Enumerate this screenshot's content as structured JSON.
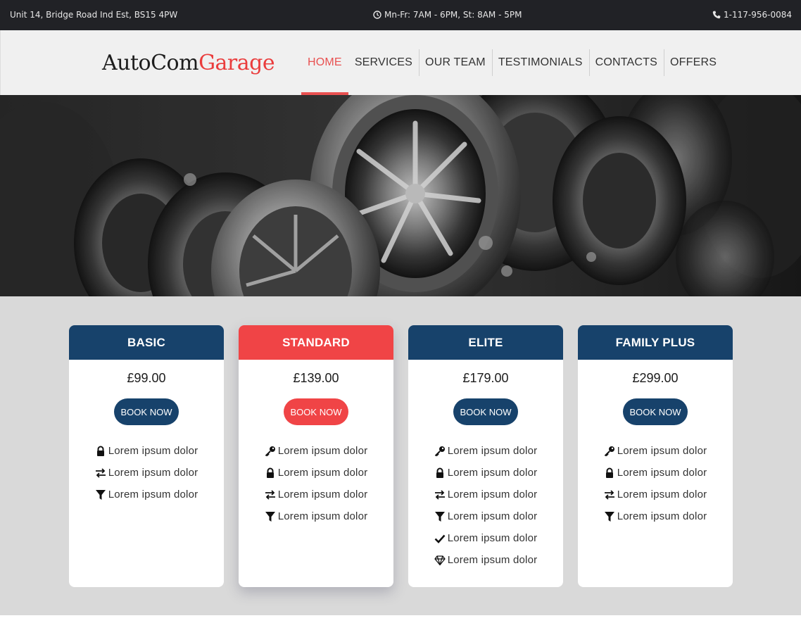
{
  "topbar": {
    "address": "Unit 14, Bridge Road Ind Est, BS15 4PW",
    "hours": "Mn-Fr: 7AM - 6PM, St: 8AM - 5PM",
    "phone": "1-117-956-0084"
  },
  "brand": {
    "part1": "AutoCom",
    "part2": "Garage"
  },
  "nav": [
    {
      "label": "HOME",
      "active": true
    },
    {
      "label": "SERVICES"
    },
    {
      "label": "OUR TEAM"
    },
    {
      "label": "TESTIMONIALS"
    },
    {
      "label": "CONTACTS"
    },
    {
      "label": "OFFERS"
    }
  ],
  "colors": {
    "navy": "#17426b",
    "red": "#f04446",
    "nav_active": "#e85151",
    "section_bg": "#d9d9d9"
  },
  "plans": [
    {
      "name": "BASIC",
      "price": "£99.00",
      "button": "BOOK NOW",
      "featured": false,
      "features": [
        {
          "icon": "lock-icon",
          "text": "Lorem ipsum dolor"
        },
        {
          "icon": "exchange-icon",
          "text": "Lorem ipsum dolor"
        },
        {
          "icon": "filter-icon",
          "text": "Lorem ipsum dolor"
        }
      ]
    },
    {
      "name": "STANDARD",
      "price": "£139.00",
      "button": "BOOK NOW",
      "featured": true,
      "features": [
        {
          "icon": "key-icon",
          "text": "Lorem ipsum dolor"
        },
        {
          "icon": "lock-icon",
          "text": "Lorem ipsum dolor"
        },
        {
          "icon": "exchange-icon",
          "text": "Lorem ipsum dolor"
        },
        {
          "icon": "filter-icon",
          "text": "Lorem ipsum dolor"
        }
      ]
    },
    {
      "name": "ELITE",
      "price": "£179.00",
      "button": "BOOK NOW",
      "featured": false,
      "features": [
        {
          "icon": "key-icon",
          "text": "Lorem ipsum dolor"
        },
        {
          "icon": "lock-icon",
          "text": "Lorem ipsum dolor"
        },
        {
          "icon": "exchange-icon",
          "text": "Lorem ipsum dolor"
        },
        {
          "icon": "filter-icon",
          "text": "Lorem ipsum dolor"
        },
        {
          "icon": "check-icon",
          "text": "Lorem ipsum dolor"
        },
        {
          "icon": "diamond-icon",
          "text": "Lorem ipsum dolor"
        }
      ]
    },
    {
      "name": "FAMILY PLUS",
      "price": "£299.00",
      "button": "BOOK NOW",
      "featured": false,
      "features": [
        {
          "icon": "key-icon",
          "text": "Lorem ipsum dolor"
        },
        {
          "icon": "lock-icon",
          "text": "Lorem ipsum dolor"
        },
        {
          "icon": "exchange-icon",
          "text": "Lorem ipsum dolor"
        },
        {
          "icon": "filter-icon",
          "text": "Lorem ipsum dolor"
        }
      ]
    }
  ]
}
